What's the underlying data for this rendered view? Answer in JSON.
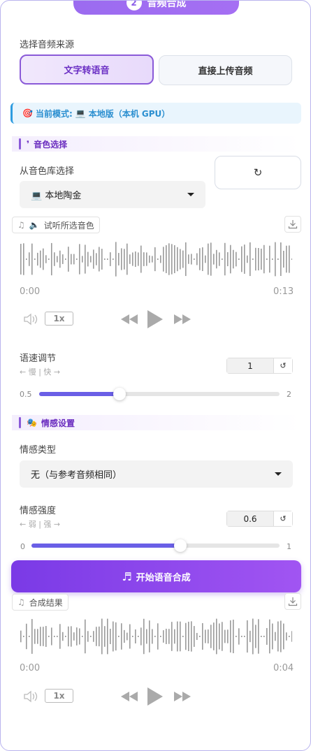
{
  "step": {
    "number": "2",
    "title": "音频合成"
  },
  "source": {
    "label": "选择音频来源",
    "tts_label": "文字转语音",
    "upload_label": "直接上传音频"
  },
  "mode": {
    "prefix": "当前模式:",
    "value": "本地版（本机 GPU）"
  },
  "voice_section": {
    "title": "音色选择",
    "library_label": "从音色库选择",
    "selected_voice": "本地陶金",
    "preview_label": "试听所选音色",
    "player": {
      "current_time": "0:00",
      "duration": "0:13",
      "speed": "1x"
    }
  },
  "speed": {
    "label": "语速调节",
    "hint": "← 慢 | 快 →",
    "value": "1",
    "min": "0.5",
    "max": "2",
    "fraction": 0.333
  },
  "emotion_section": {
    "title": "情感设置",
    "type_label": "情感类型",
    "type_value": "无（与参考音频相同）",
    "strength_label": "情感强度",
    "strength_hint": "← 弱 | 强 →",
    "strength_value": "0.6",
    "strength_min": "0",
    "strength_max": "1",
    "strength_fraction": 0.6
  },
  "synth_button": "开始语音合成",
  "result": {
    "label": "合成结果",
    "player": {
      "current_time": "0:00",
      "duration": "0:04",
      "speed": "1x"
    }
  },
  "colors": {
    "accent": "#7a3ae6",
    "info": "#2b8fd0",
    "slider": "#6a5fe6"
  }
}
